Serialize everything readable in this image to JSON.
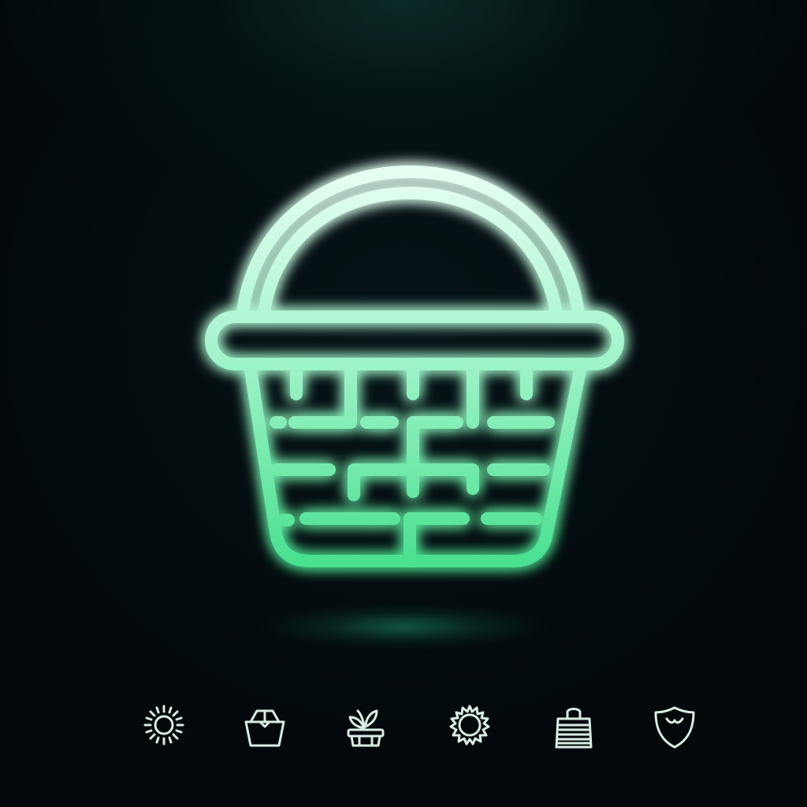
{
  "hero": {
    "icon": "basket-icon",
    "glow_color": "#2edca0",
    "stroke_top_color": "#e9fff4",
    "stroke_bottom_color": "#48e08e"
  },
  "icon_row": {
    "color": "#d8ece4",
    "icons": [
      {
        "name": "sun-icon"
      },
      {
        "name": "shopping-bag-icon"
      },
      {
        "name": "plant-basket-icon"
      },
      {
        "name": "gear-icon"
      },
      {
        "name": "tote-bag-icon"
      },
      {
        "name": "shield-icon"
      }
    ]
  }
}
